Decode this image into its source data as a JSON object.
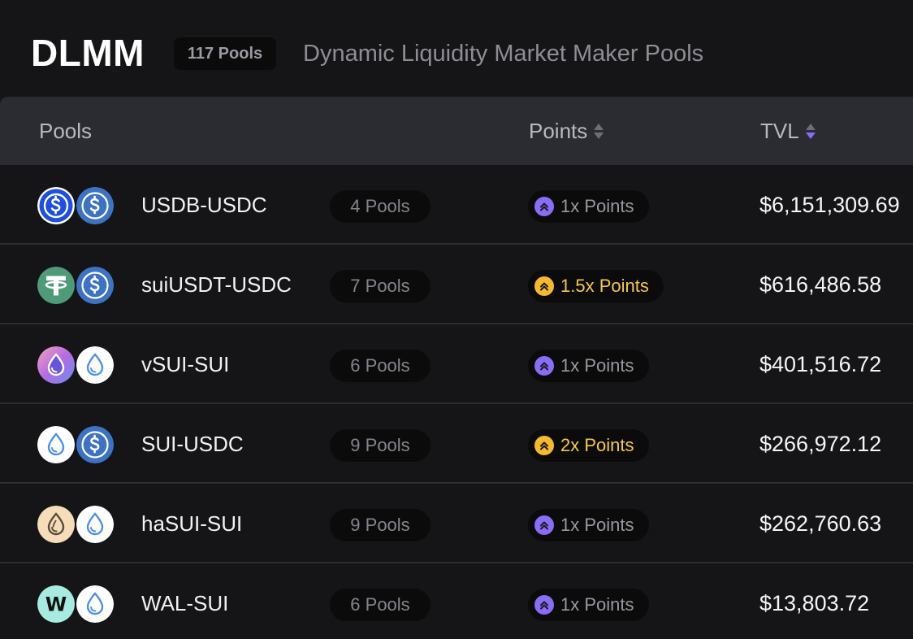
{
  "header": {
    "title": "DLMM",
    "pool_count_badge": "117 Pools",
    "subtitle": "Dynamic Liquidity Market Maker Pools"
  },
  "table": {
    "columns": {
      "pools": "Pools",
      "points": "Points",
      "tvl": "TVL"
    },
    "active_sort_column": "TVL",
    "active_sort_direction": "descending",
    "rows": [
      {
        "pair": "USDB-USDC",
        "tokens": [
          "usdb-icon",
          "usdc-icon"
        ],
        "pool_count": "4 Pools",
        "points": "1x Points",
        "points_tier": "purple",
        "tvl": "$6,151,309.69"
      },
      {
        "pair": "suiUSDT-USDC",
        "tokens": [
          "usdt-icon",
          "usdc-icon"
        ],
        "pool_count": "7 Pools",
        "points": "1.5x Points",
        "points_tier": "gold",
        "tvl": "$616,486.58"
      },
      {
        "pair": "vSUI-SUI",
        "tokens": [
          "vsui-icon",
          "sui-icon"
        ],
        "pool_count": "6 Pools",
        "points": "1x Points",
        "points_tier": "purple",
        "tvl": "$401,516.72"
      },
      {
        "pair": "SUI-USDC",
        "tokens": [
          "sui-icon",
          "usdc-icon"
        ],
        "pool_count": "9 Pools",
        "points": "2x Points",
        "points_tier": "gold",
        "tvl": "$266,972.12"
      },
      {
        "pair": "haSUI-SUI",
        "tokens": [
          "hasui-icon",
          "sui-icon"
        ],
        "pool_count": "9 Pools",
        "points": "1x Points",
        "points_tier": "purple",
        "tvl": "$262,760.63"
      },
      {
        "pair": "WAL-SUI",
        "tokens": [
          "wal-icon",
          "sui-icon"
        ],
        "pool_count": "6 Pools",
        "points": "1x Points",
        "points_tier": "purple",
        "tvl": "$13,803.72"
      }
    ]
  },
  "colors": {
    "background": "#151517",
    "header_row": "#2b2c31",
    "accent_purple": "#8a6cf6",
    "accent_gold": "#f4b92c",
    "usdc_blue": "#3e73c4",
    "usdb_blue": "#1f4ee0",
    "usdt_green": "#4f9a79"
  }
}
